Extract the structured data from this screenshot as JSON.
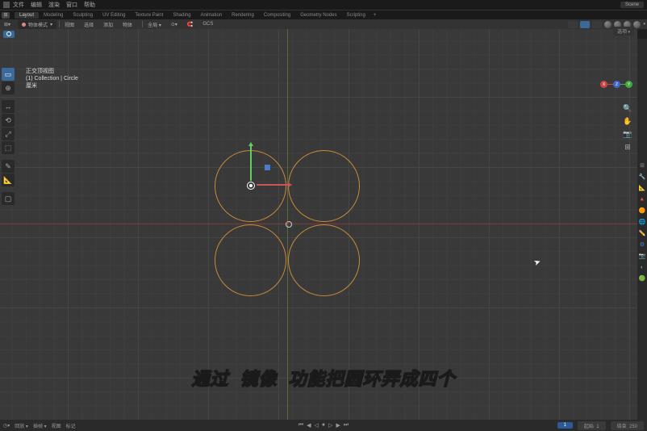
{
  "topMenu": {
    "items": [
      "文件",
      "编辑",
      "渲染",
      "窗口",
      "帮助"
    ],
    "sceneLabel": "Scene"
  },
  "workspaces": {
    "tabs": [
      "Layout",
      "Modeling",
      "Sculpting",
      "UV Editing",
      "Texture Paint",
      "Shading",
      "Animation",
      "Rendering",
      "Compositing",
      "Geometry Nodes",
      "Scripting"
    ],
    "plus": "+",
    "activeIndex": 0
  },
  "viewportHeader": {
    "mode": "物体模式",
    "menus": [
      "视图",
      "选择",
      "添加",
      "物体"
    ],
    "transform": "全局",
    "orient": "GCS"
  },
  "options": {
    "label": "选项"
  },
  "info": {
    "title": "正交顶视图",
    "collection": "(1) Collection | Circle",
    "units": "厘米"
  },
  "navAxes": {
    "x": "X",
    "y": "Y",
    "z": "Z"
  },
  "rightPanelIcons": [
    "⊞",
    "🔧",
    "📐",
    "🔺",
    "🟠",
    "🌐",
    "✏️",
    "⚙",
    "📷",
    "◐",
    "🟢"
  ],
  "subtitle": {
    "t1": "通过",
    "t2": "镜像",
    "t3": "功能把圆环弄成四个"
  },
  "timeline": {
    "left": [
      "回放 ▾",
      "插帧 ▾",
      "视图",
      "标记"
    ],
    "controls": [
      "⏮",
      "◀",
      "◁",
      "●",
      "▷",
      "▶",
      "⏭"
    ],
    "frame": "1",
    "startLabel": "起始",
    "start": "1",
    "endLabel": "结束",
    "end": "250"
  },
  "leftTools": [
    "▭",
    "⊕",
    "↔",
    "⟲",
    "⤢",
    "⬚",
    "—",
    "✎",
    "📐",
    "—",
    "▢"
  ]
}
